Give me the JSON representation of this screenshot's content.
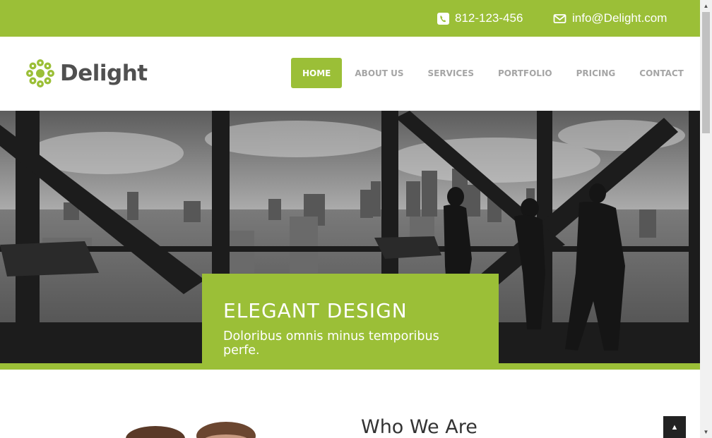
{
  "topbar": {
    "phone": "812-123-456",
    "email": "info@Delight.com",
    "phone_icon": "phone-icon",
    "email_icon": "envelope-icon"
  },
  "brand": {
    "name": "Delight",
    "logo_icon": "flower-icon",
    "accent_color": "#9bbf37"
  },
  "nav": {
    "items": [
      {
        "label": "HOME",
        "active": true
      },
      {
        "label": "ABOUT US"
      },
      {
        "label": "SERVICES"
      },
      {
        "label": "PORTFOLIO"
      },
      {
        "label": "PRICING"
      },
      {
        "label": "CONTACT"
      }
    ]
  },
  "hero": {
    "title": "ELEGANT DESIGN",
    "subtitle": "Doloribus omnis minus temporibus perfe."
  },
  "about": {
    "heading": "Who We Are"
  },
  "scroll_top_icon": "chevron-up-icon"
}
